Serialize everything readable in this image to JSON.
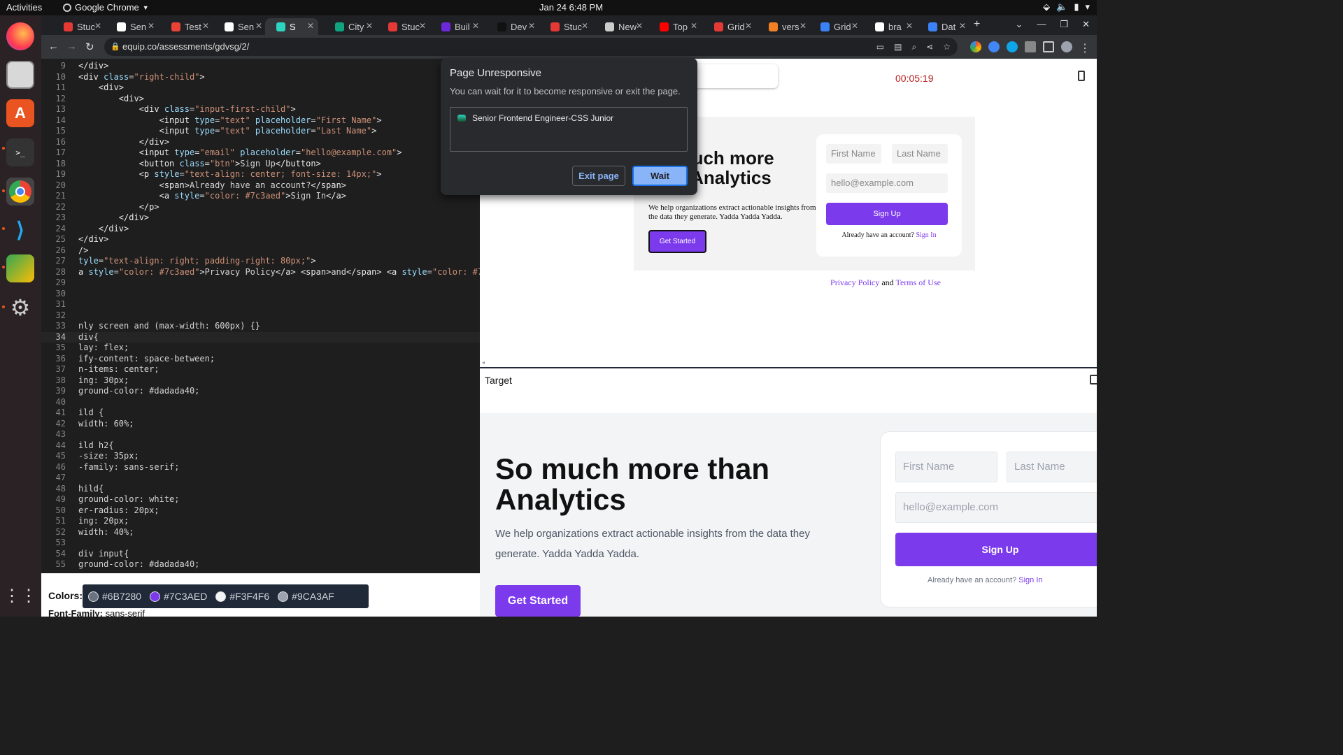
{
  "topbar": {
    "activities": "Activities",
    "app_name": "Google Chrome",
    "clock": "Jan 24  6:48 PM"
  },
  "dock": {
    "apps": [
      "firefox-icon",
      "files-icon",
      "app-center-icon",
      "terminal-icon",
      "chrome-icon",
      "vscode-icon",
      "chat-icon",
      "settings-icon",
      "app-grid-icon"
    ]
  },
  "tabs": [
    {
      "label": "Stuc",
      "color": "#e53935"
    },
    {
      "label": "Sen",
      "color": "#ffffff"
    },
    {
      "label": "Test",
      "color": "#ea4335"
    },
    {
      "label": "Sen",
      "color": "#ffffff"
    },
    {
      "label": "S",
      "color": "#2dd4bf"
    },
    {
      "label": "City",
      "color": "#10a37f"
    },
    {
      "label": "Stuc",
      "color": "#e53935"
    },
    {
      "label": "Buil",
      "color": "#6d28d9"
    },
    {
      "label": "Dev",
      "color": "#111111"
    },
    {
      "label": "Stuc",
      "color": "#e53935"
    },
    {
      "label": "New",
      "color": "#cccccc"
    },
    {
      "label": "Top",
      "color": "#ff0000"
    },
    {
      "label": "Grid",
      "color": "#e53935"
    },
    {
      "label": "vers",
      "color": "#f48024"
    },
    {
      "label": "Grid",
      "color": "#3b82f6"
    },
    {
      "label": "bra",
      "color": "#ffffff"
    },
    {
      "label": "Dat",
      "color": "#3b82f6"
    }
  ],
  "omnibox": {
    "url": "equip.co/assessments/gdvsg/2/"
  },
  "editor": {
    "lines": [
      {
        "n": "9",
        "html": "<span class='tg'>&lt;/div&gt;</span>"
      },
      {
        "n": "10",
        "html": "<span class='tg'>&lt;div</span> <span class='at'>class</span>=<span class='st'>\"right-child\"</span><span class='tg'>&gt;</span>"
      },
      {
        "n": "11",
        "html": "    <span class='tg'>&lt;div&gt;</span>"
      },
      {
        "n": "12",
        "html": "        <span class='tg'>&lt;div&gt;</span>"
      },
      {
        "n": "13",
        "html": "            <span class='tg'>&lt;div</span> <span class='at'>class</span>=<span class='st'>\"input-first-child\"</span><span class='tg'>&gt;</span>"
      },
      {
        "n": "14",
        "html": "                <span class='tg'>&lt;input</span> <span class='at'>type</span>=<span class='st'>\"text\"</span> <span class='at'>placeholder</span>=<span class='st'>\"First Name\"</span><span class='tg'>&gt;</span>"
      },
      {
        "n": "15",
        "html": "                <span class='tg'>&lt;input</span> <span class='at'>type</span>=<span class='st'>\"text\"</span> <span class='at'>placeholder</span>=<span class='st'>\"Last Name\"</span><span class='tg'>&gt;</span>"
      },
      {
        "n": "16",
        "html": "            <span class='tg'>&lt;/div&gt;</span>"
      },
      {
        "n": "17",
        "html": "            <span class='tg'>&lt;input</span> <span class='at'>type</span>=<span class='st'>\"email\"</span> <span class='at'>placeholder</span>=<span class='st'>\"hello@example.com\"</span><span class='tg'>&gt;</span>"
      },
      {
        "n": "18",
        "html": "            <span class='tg'>&lt;button</span> <span class='at'>class</span>=<span class='st'>\"btn\"</span><span class='tg'>&gt;</span>Sign Up<span class='tg'>&lt;/button&gt;</span>"
      },
      {
        "n": "19",
        "html": "            <span class='tg'>&lt;p</span> <span class='at'>style</span>=<span class='st'>\"text-align: center; font-size: 14px;\"</span><span class='tg'>&gt;</span>"
      },
      {
        "n": "20",
        "html": "                <span class='tg'>&lt;span&gt;</span>Already have an account?<span class='tg'>&lt;/span&gt;</span>"
      },
      {
        "n": "21",
        "html": "                <span class='tg'>&lt;a</span> <span class='at'>style</span>=<span class='st'>\"color: #7c3aed\"</span><span class='tg'>&gt;</span>Sign In<span class='tg'>&lt;/a&gt;</span>"
      },
      {
        "n": "22",
        "html": "            <span class='tg'>&lt;/p&gt;</span>"
      },
      {
        "n": "23",
        "html": "        <span class='tg'>&lt;/div&gt;</span>"
      },
      {
        "n": "24",
        "html": "    <span class='tg'>&lt;/div&gt;</span>"
      },
      {
        "n": "25",
        "html": "<span class='tg'>&lt;/div&gt;</span>"
      },
      {
        "n": "26",
        "html": "<span class='tg'>/&gt;</span>"
      },
      {
        "n": "27",
        "html": "<span class='at'>tyle</span>=<span class='st'>\"text-align: right; padding-right: 80px;\"</span><span class='tg'>&gt;</span>"
      },
      {
        "n": "28",
        "html": "<span class='tg'>a</span> <span class='at'>style</span>=<span class='st'>\"color: #7c3aed\"</span><span class='tg'>&gt;</span>Privacy Policy<span class='tg'>&lt;/a&gt;</span> <span class='tg'>&lt;span&gt;</span>and<span class='tg'>&lt;/span&gt;</span> <span class='tg'>&lt;a</span> <span class='at'>style</span>=<span class='st'>\"color: #7c3a</span>"
      },
      {
        "n": "29",
        "html": ""
      },
      {
        "n": "30",
        "html": ""
      },
      {
        "n": "31",
        "html": ""
      },
      {
        "n": "32",
        "html": ""
      },
      {
        "n": "33",
        "html": "nly screen and (max-width: 600px) {}"
      },
      {
        "n": "34",
        "html": "div{",
        "cur": true
      },
      {
        "n": "35",
        "html": "lay: flex;"
      },
      {
        "n": "36",
        "html": "ify-content: space-between;"
      },
      {
        "n": "37",
        "html": "n-items: center;"
      },
      {
        "n": "38",
        "html": "ing: 30px;"
      },
      {
        "n": "39",
        "html": "ground-color: #dadada40;"
      },
      {
        "n": "40",
        "html": ""
      },
      {
        "n": "41",
        "html": "ild {"
      },
      {
        "n": "42",
        "html": "width: 60%;"
      },
      {
        "n": "43",
        "html": ""
      },
      {
        "n": "44",
        "html": "ild h2{"
      },
      {
        "n": "45",
        "html": "-size: 35px;"
      },
      {
        "n": "46",
        "html": "-family: sans-serif;"
      },
      {
        "n": "47",
        "html": ""
      },
      {
        "n": "48",
        "html": "hild{"
      },
      {
        "n": "49",
        "html": "ground-color: white;"
      },
      {
        "n": "50",
        "html": "er-radius: 20px;"
      },
      {
        "n": "51",
        "html": "ing: 20px;"
      },
      {
        "n": "52",
        "html": "width: 40%;"
      },
      {
        "n": "53",
        "html": ""
      },
      {
        "n": "54",
        "html": "div input{"
      },
      {
        "n": "55",
        "html": "ground-color: #dadada40;"
      }
    ]
  },
  "colors": {
    "label": "Colors:",
    "items": [
      {
        "hex": "#6B7280"
      },
      {
        "hex": "#7C3AED"
      },
      {
        "hex": "#F3F4F6"
      },
      {
        "hex": "#9CA3AF"
      }
    ],
    "font_family_label": "Font-Family:",
    "font_family_value": "sans-serif"
  },
  "output": {
    "timer": "00:05:19",
    "heading": "So much more than Analytics",
    "paragraph": "We help organizations extract actionable insights from the data they generate. Yadda Yadda Yadda.",
    "get_started": "Get Started",
    "first_name": "First Name",
    "last_name": "Last Name",
    "email": "hello@example.com",
    "sign_up": "Sign Up",
    "already": "Already have an account?",
    "sign_in": "Sign In",
    "privacy": "Privacy Policy",
    "and": "and",
    "terms": "Terms of Use"
  },
  "target": {
    "label": "Target",
    "heading": "So much more than Analytics",
    "paragraph": "We help organizations extract actionable insights from the data they generate. Yadda Yadda Yadda.",
    "get_started": "Get Started",
    "first_name": "First Name",
    "last_name": "Last Name",
    "email": "hello@example.com",
    "sign_up": "Sign Up",
    "already": "Already have an account?",
    "sign_in": "Sign In"
  },
  "dialog": {
    "title": "Page Unresponsive",
    "text": "You can wait for it to become responsive or exit the page.",
    "page_title": "Senior Frontend Engineer-CSS Junior",
    "exit": "Exit page",
    "wait": "Wait"
  }
}
